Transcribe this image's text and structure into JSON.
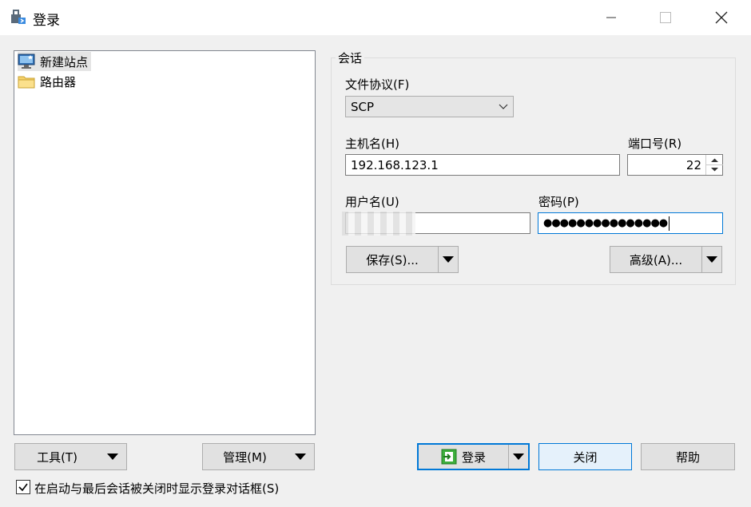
{
  "window": {
    "title": "登录"
  },
  "tree": {
    "items": [
      {
        "label": "新建站点",
        "icon": "computer-icon",
        "selected": true
      },
      {
        "label": "路由器",
        "icon": "folder-icon",
        "selected": false
      }
    ]
  },
  "session": {
    "group_label": "会话",
    "protocol_label": "文件协议(F)",
    "protocol_value": "SCP",
    "host_label": "主机名(H)",
    "host_value": "192.168.123.1",
    "port_label": "端口号(R)",
    "port_value": "22",
    "user_label": "用户名(U)",
    "user_value": "",
    "password_label": "密码(P)",
    "password_value": "●●●●●●●●●●●●●●●",
    "save_label": "保存(S)...",
    "advanced_label": "高级(A)..."
  },
  "bottom": {
    "tools_label": "工具(T)",
    "manage_label": "管理(M)",
    "login_label": "登录",
    "close_label": "关闭",
    "help_label": "帮助",
    "checkbox_label": "在启动与最后会话被关闭时显示登录对话框(S)",
    "checkbox_checked": true
  },
  "colors": {
    "accent": "#0078d7",
    "client_bg": "#f0f0f0"
  }
}
